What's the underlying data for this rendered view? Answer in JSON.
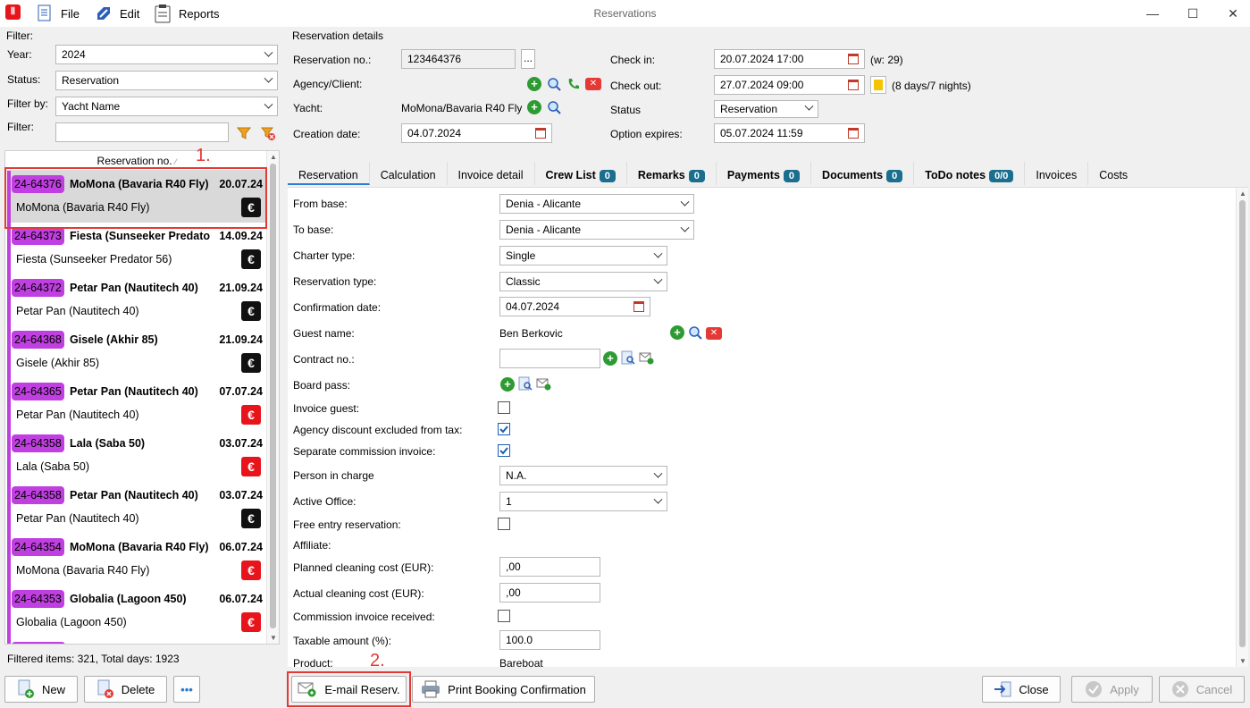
{
  "window": {
    "title": "Reservations"
  },
  "menu": {
    "file": "File",
    "edit": "Edit",
    "reports": "Reports"
  },
  "filter": {
    "section_label": "Filter:",
    "year_label": "Year:",
    "year_value": "2024",
    "status_label": "Status:",
    "status_value": "Reservation",
    "filter_by_label": "Filter by:",
    "filter_by_value": "Yacht Name",
    "filter_label": "Filter:",
    "filter_value": ""
  },
  "list": {
    "header": "Reservation no.",
    "items": [
      {
        "id": "24-64376",
        "name": "MoMona (Bavaria R40 Fly)",
        "date": "20.07.24",
        "sub": "MoMona (Bavaria R40 Fly)",
        "eur_color": "#111111"
      },
      {
        "id": "24-64373",
        "name": "Fiesta (Sunseeker Predato",
        "date": "14.09.24",
        "sub": "Fiesta (Sunseeker Predator 56)",
        "eur_color": "#111111"
      },
      {
        "id": "24-64372",
        "name": "Petar Pan (Nautitech 40)",
        "date": "21.09.24",
        "sub": "Petar Pan (Nautitech 40)",
        "eur_color": "#111111"
      },
      {
        "id": "24-64368",
        "name": "Gisele (Akhir 85)",
        "date": "21.09.24",
        "sub": "Gisele (Akhir 85)",
        "eur_color": "#111111"
      },
      {
        "id": "24-64365",
        "name": "Petar Pan (Nautitech 40)",
        "date": "07.07.24",
        "sub": "Petar Pan (Nautitech 40)",
        "eur_color": "#e8141c"
      },
      {
        "id": "24-64358",
        "name": "Lala (Saba 50)",
        "date": "03.07.24",
        "sub": "Lala (Saba 50)",
        "eur_color": "#e8141c"
      },
      {
        "id": "24-64358",
        "name": "Petar Pan (Nautitech 40)",
        "date": "03.07.24",
        "sub": "Petar Pan (Nautitech 40)",
        "eur_color": "#111111"
      },
      {
        "id": "24-64354",
        "name": "MoMona (Bavaria R40 Fly)",
        "date": "06.07.24",
        "sub": "MoMona (Bavaria R40 Fly)",
        "eur_color": "#e8141c"
      },
      {
        "id": "24-64353",
        "name": "Globalia (Lagoon 450)",
        "date": "06.07.24",
        "sub": "Globalia (Lagoon 450)",
        "eur_color": "#e8141c"
      }
    ],
    "euro_symbol": "€",
    "footer": "Filtered items: 321,  Total days: 1923"
  },
  "details": {
    "section_label": "Reservation details",
    "res_no_label": "Reservation no.:",
    "res_no_value": "123464376",
    "ellipsis": "...",
    "agency_label": "Agency/Client:",
    "yacht_label": "Yacht:",
    "yacht_value": "MoMona/Bavaria R40 Fly",
    "creation_label": "Creation date:",
    "creation_value": "04.07.2024",
    "checkin_label": "Check in:",
    "checkin_value": "20.07.2024 17:00",
    "checkin_note": "(w: 29)",
    "checkout_label": "Check out:",
    "checkout_value": "27.07.2024 09:00",
    "checkout_note": "(8 days/7 nights)",
    "status_label": "Status",
    "status_value": "Reservation",
    "option_label": "Option expires:",
    "option_value": "05.07.2024 11:59"
  },
  "tabs": [
    {
      "label": "Reservation",
      "count": ""
    },
    {
      "label": "Calculation",
      "count": ""
    },
    {
      "label": "Invoice detail",
      "count": ""
    },
    {
      "label": "Crew List",
      "count": "0"
    },
    {
      "label": "Remarks",
      "count": "0"
    },
    {
      "label": "Payments",
      "count": "0"
    },
    {
      "label": "Documents",
      "count": "0"
    },
    {
      "label": "ToDo notes",
      "count": "0/0"
    },
    {
      "label": "Invoices",
      "count": ""
    },
    {
      "label": "Costs",
      "count": ""
    }
  ],
  "form": {
    "from_base_label": "From base:",
    "from_base_value": "Denia - Alicante",
    "to_base_label": "To base:",
    "to_base_value": "Denia - Alicante",
    "charter_type_label": "Charter type:",
    "charter_type_value": "Single",
    "res_type_label": "Reservation type:",
    "res_type_value": "Classic",
    "conf_date_label": "Confirmation date:",
    "conf_date_value": "04.07.2024",
    "guest_label": "Guest name:",
    "guest_value": "Ben Berkovic",
    "contract_label": "Contract no.:",
    "contract_value": "",
    "board_label": "Board pass:",
    "invoice_guest_label": "Invoice guest:",
    "invoice_guest_checked": false,
    "agency_disc_label": "Agency discount excluded from tax:",
    "agency_disc_checked": true,
    "sep_comm_label": "Separate commission invoice:",
    "sep_comm_checked": true,
    "person_label": "Person in charge",
    "person_value": "N.A.",
    "office_label": "Active Office:",
    "office_value": "1",
    "free_entry_label": "Free entry reservation:",
    "free_entry_checked": false,
    "affiliate_label": "Affiliate:",
    "planned_label": "Planned cleaning cost (EUR):",
    "planned_value": ",00",
    "actual_label": "Actual cleaning cost (EUR):",
    "actual_value": ",00",
    "comm_recv_label": "Commission invoice received:",
    "comm_recv_checked": false,
    "taxable_label": "Taxable amount (%):",
    "taxable_value": "100.0",
    "product_label": "Product:",
    "product_value": "Bareboat"
  },
  "buttons": {
    "new": "New",
    "delete": "Delete",
    "more": "•••",
    "email": "E-mail Reserv.",
    "print": "Print Booking Confirmation",
    "close": "Close",
    "apply": "Apply",
    "cancel": "Cancel"
  },
  "annotations": {
    "one": "1.",
    "two": "2."
  },
  "colors": {
    "badge": "#c03fe0",
    "highlight_box": "#e53935",
    "tab_count": "#1a6e8e"
  }
}
